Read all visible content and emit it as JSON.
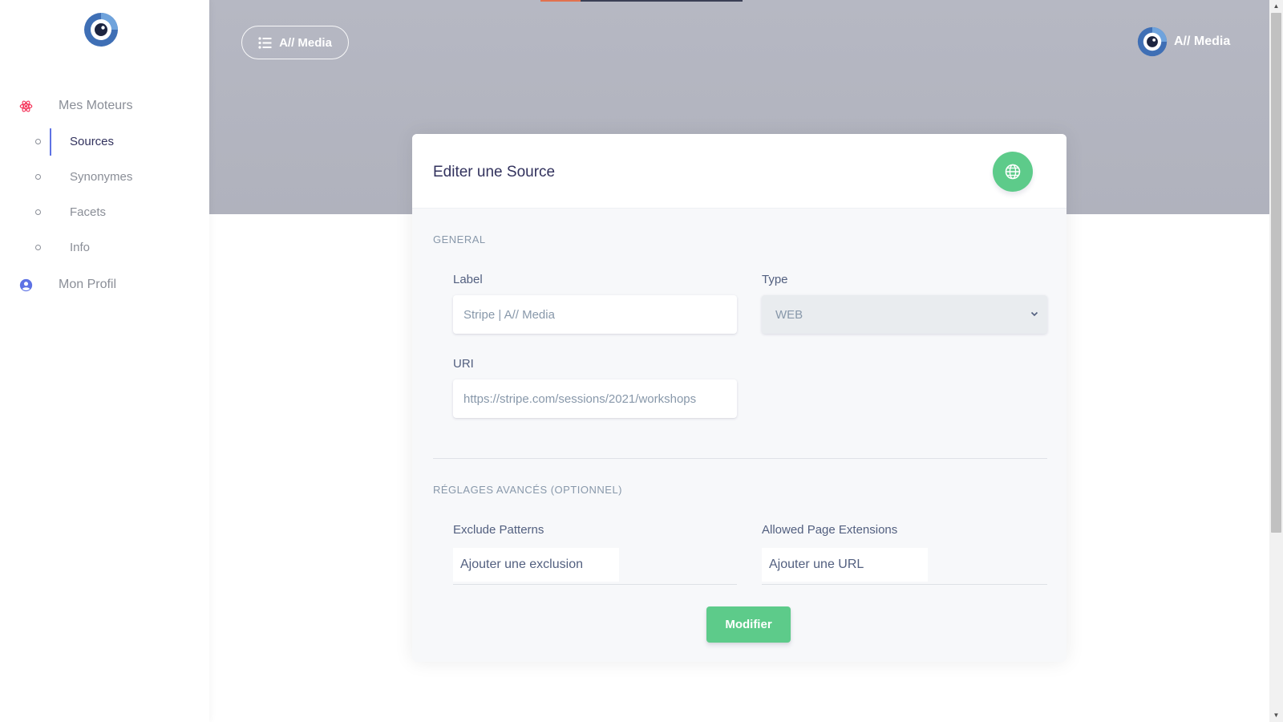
{
  "sidebar": {
    "items": [
      {
        "label": "Mes Moteurs",
        "icon": "atom-icon"
      },
      {
        "label": "Mon Profil",
        "icon": "user-circle-icon"
      }
    ],
    "sub_items": [
      {
        "label": "Sources",
        "active": true
      },
      {
        "label": "Synonymes",
        "active": false
      },
      {
        "label": "Facets",
        "active": false
      },
      {
        "label": "Info",
        "active": false
      }
    ]
  },
  "header": {
    "menu_button_label": "A// Media",
    "brand_name": "A// Media",
    "loading_progress": 0.2
  },
  "card": {
    "title": "Editer une Source",
    "general_section": "GENERAL",
    "label_field": {
      "label": "Label",
      "value": "Stripe | A// Media"
    },
    "type_field": {
      "label": "Type",
      "value": "WEB"
    },
    "uri_field": {
      "label": "URI",
      "value": "https://stripe.com/sessions/2021/workshops"
    },
    "advanced_section": "RÉGLAGES AVANCÉS (OPTIONNEL)",
    "exclude_field": {
      "label": "Exclude Patterns",
      "placeholder": "Ajouter une exclusion"
    },
    "extensions_field": {
      "label": "Allowed Page Extensions",
      "placeholder": "Ajouter une URL"
    },
    "submit_label": "Modifier"
  },
  "colors": {
    "accent_green": "#5dcb8a",
    "active_bar": "#5e72e4",
    "atom_icon": "#f5365c",
    "profile_icon": "#5e72e4",
    "progress_fill": "#e2724f"
  }
}
